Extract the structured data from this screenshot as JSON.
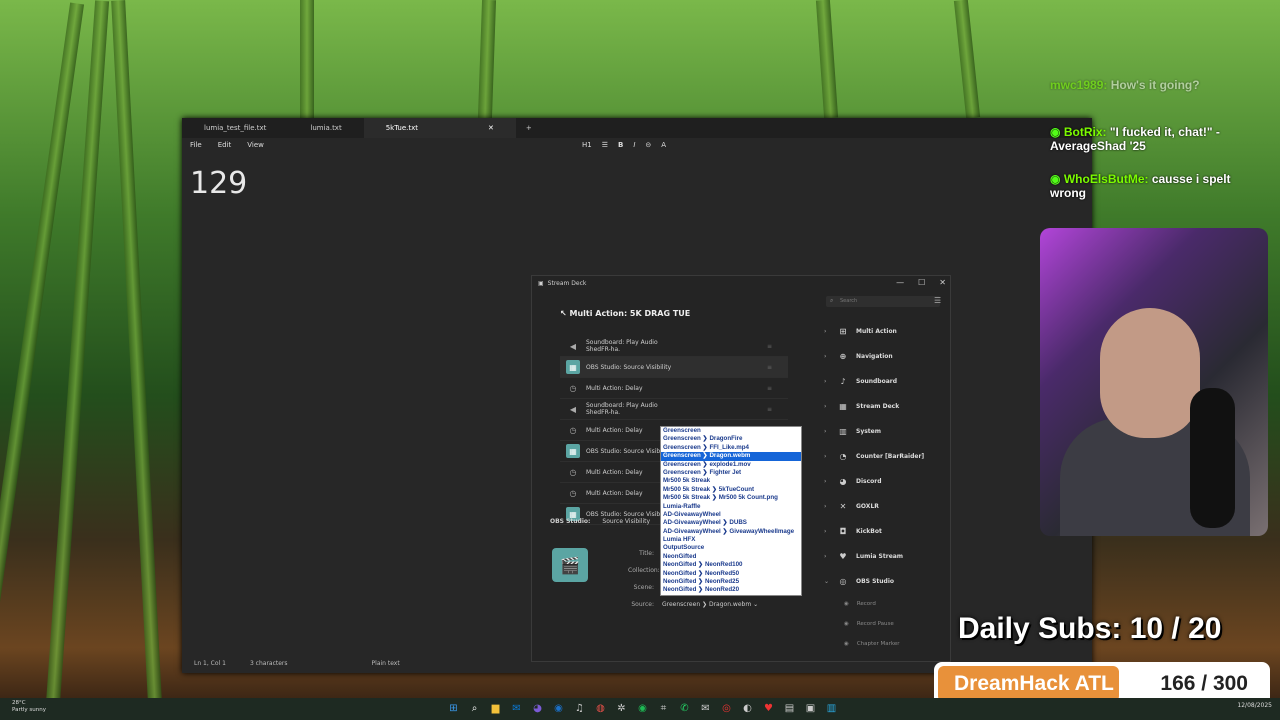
{
  "notepad": {
    "tabs": [
      "lumia_test_file.txt",
      "lumia.txt",
      "5kTue.txt"
    ],
    "menu": [
      "File",
      "Edit",
      "View"
    ],
    "format_heading": "H1",
    "content": "129",
    "status": {
      "position": "Ln 1, Col 1",
      "chars": "3 characters",
      "type": "Plain text"
    }
  },
  "chat": [
    {
      "user": "mwc1989:",
      "message": "How's it going?"
    },
    {
      "user": "BotRix:",
      "message": "\"I fucked it, chat!\" - AverageShad '25"
    },
    {
      "user": "WhoElsButMe:",
      "message": "causse i spelt wrong"
    }
  ],
  "streamdeck": {
    "window_title": "Stream Deck",
    "action_title": "Multi Action: 5K DRAG TUE",
    "actions": [
      {
        "label": "Soundboard: Play Audio",
        "sub": "ShedFR-ha.",
        "icon": "speaker-icon"
      },
      {
        "label": "OBS Studio: Source Visibility",
        "sub": "",
        "icon": "obs-icon"
      },
      {
        "label": "Multi Action: Delay",
        "sub": "",
        "icon": "timer-icon"
      },
      {
        "label": "Soundboard: Play Audio",
        "sub": "ShedFR-ha.",
        "icon": "speaker-icon"
      },
      {
        "label": "Multi Action: Delay",
        "sub": "",
        "icon": "timer-icon"
      },
      {
        "label": "OBS Studio: Source Visibility",
        "sub": "",
        "icon": "obs-icon"
      },
      {
        "label": "Multi Action: Delay",
        "sub": "",
        "icon": "timer-icon"
      },
      {
        "label": "Multi Action: Delay",
        "sub": "",
        "icon": "timer-icon"
      },
      {
        "label": "OBS Studio: Source Visibility",
        "sub": "",
        "icon": "obs-icon"
      }
    ],
    "props_title": "OBS Studio:",
    "props_sub": "Source Visibility",
    "field_labels": {
      "title": "Title:",
      "collection": "Collection:",
      "scene": "Scene:",
      "source": "Source:"
    },
    "source_value": "Greenscreen ❯ Dragon.webm",
    "search_placeholder": "Search",
    "categories": [
      "Multi Action",
      "Navigation",
      "Soundboard",
      "Stream Deck",
      "System",
      "Counter [BarRaider]",
      "Discord",
      "GOXLR",
      "KickBot",
      "Lumia Stream",
      "OBS Studio"
    ],
    "obs_sub": [
      "Record",
      "Record Pause",
      "Chapter Marker"
    ]
  },
  "dropdown": {
    "items": [
      "Greenscreen",
      "Greenscreen ❯ DragonFire",
      "Greenscreen ❯ FFI_Like.mp4",
      "Greenscreen ❯ Dragon.webm",
      "Greenscreen ❯ explode1.mov",
      "Greenscreen ❯ Fighter Jet",
      "Mr500 5k Streak",
      "Mr500 5k Streak ❯ 5kTueCount",
      "Mr500 5k Streak ❯ Mr500 5k Count.png",
      "Lumia-Raffle",
      "AD-GiveawayWheel",
      "AD-GiveawayWheel ❯ DUBS",
      "AD-GiveawayWheel ❯ GiveawayWheelImage",
      "Lumia HFX",
      "OutputSource",
      "NeonGifted",
      "NeonGifted ❯ NeonRed100",
      "NeonGifted ❯ NeonRed50",
      "NeonGifted ❯ NeonRed25",
      "NeonGifted ❯ NeonRed20"
    ],
    "selected": 3
  },
  "overlay": {
    "daily_subs": "Daily Subs:  10 / 20",
    "goal_label": "DreamHack ATL",
    "goal_count": "166 / 300",
    "goal_progress": 0.553
  },
  "taskbar": {
    "weather_temp": "28°C",
    "weather_desc": "Partly sunny",
    "date": "12/08/2025"
  }
}
